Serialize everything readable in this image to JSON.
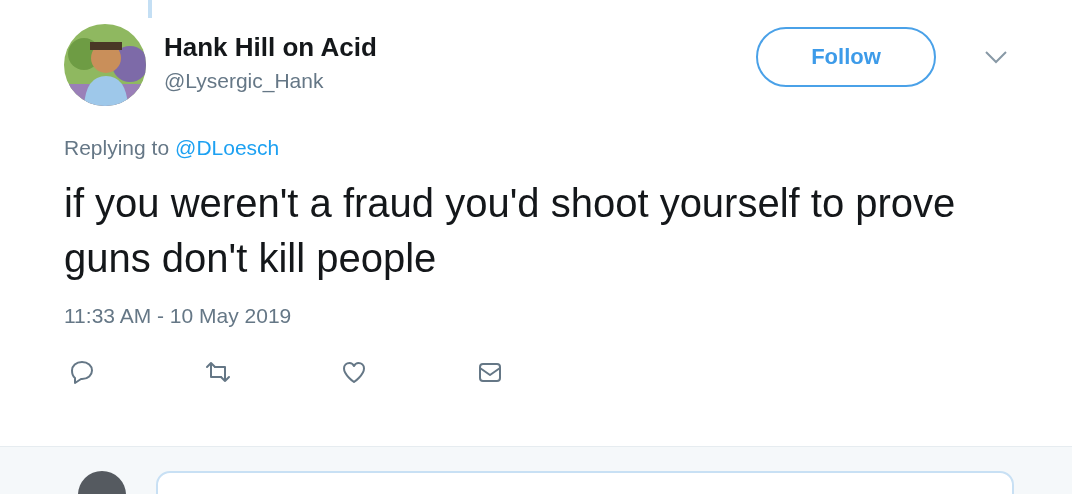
{
  "tweet": {
    "author": {
      "name": "Hank Hill on Acid",
      "handle": "@Lysergic_Hank"
    },
    "follow_button": {
      "label": "Follow"
    },
    "replying_prefix": "Replying to",
    "replying_to": "@DLoesch",
    "text": "if you weren't a fraud you'd shoot yourself to prove guns don't kill people",
    "timestamp": "11:33 AM - 10 May 2019",
    "actions": [
      {
        "kind": "reply"
      },
      {
        "kind": "retweet"
      },
      {
        "kind": "like"
      },
      {
        "kind": "message"
      }
    ]
  },
  "reply_bar": {
    "kind": "compose"
  }
}
